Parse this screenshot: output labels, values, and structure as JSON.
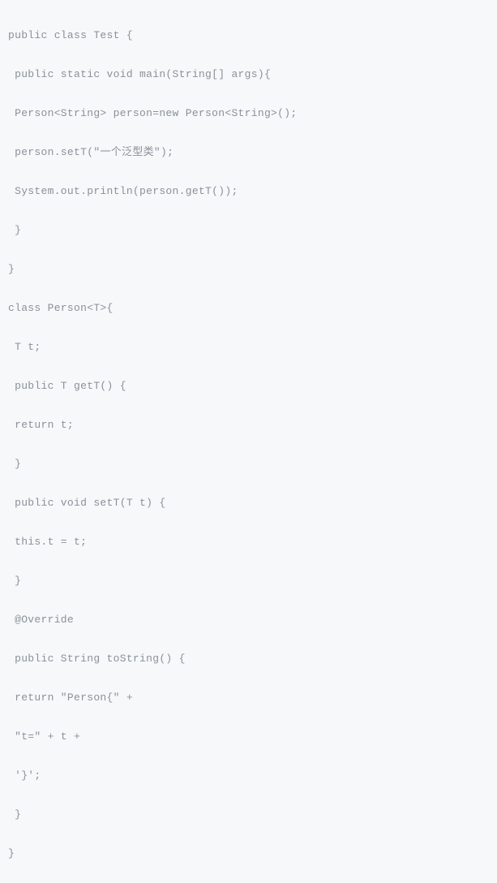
{
  "code": {
    "lines": [
      "public class Test {",
      " public static void main(String[] args){",
      " Person<String> person=new Person<String>();",
      " person.setT(\"一个泛型类\");",
      " System.out.println(person.getT());",
      " }",
      "}",
      "class Person<T>{",
      " T t;",
      " public T getT() {",
      " return t;",
      " }",
      " public void setT(T t) {",
      " this.t = t;",
      " }",
      " @Override",
      " public String toString() {",
      " return \"Person{\" +",
      " \"t=\" + t +",
      " '}';",
      " }",
      "}"
    ]
  }
}
